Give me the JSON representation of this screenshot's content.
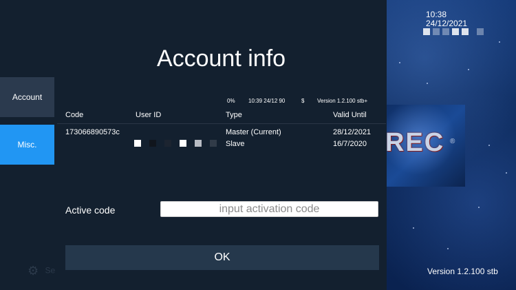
{
  "header": {
    "time": "10:38",
    "date": "24/12/2021"
  },
  "banner": {
    "text": "REC",
    "reg_mark": "®"
  },
  "footer": {
    "version": "Version 1.2.100 stb",
    "settings_label": "Se"
  },
  "sidebar": {
    "items": [
      {
        "label": "Account"
      },
      {
        "label": "Misc."
      }
    ]
  },
  "dialog": {
    "title": "Account info",
    "status": {
      "percent": "0%",
      "datetime": "10:39 24/12 90",
      "currency": "$",
      "version": "Version 1.2.100 stb+"
    },
    "table": {
      "headers": [
        "Code",
        "User ID",
        "Type",
        "Valid Until"
      ],
      "rows": [
        {
          "code": "173066890573c",
          "type": "Master (Current)",
          "valid_until": "28/12/2021"
        },
        {
          "code": "",
          "type": "Slave",
          "valid_until": "16/7/2020"
        }
      ]
    },
    "active_code_label": "Active code",
    "active_code_placeholder": "input activation code",
    "ok_label": "OK"
  },
  "colors": {
    "panel_bg": "#13202f",
    "accent_selected": "#2196f3",
    "button_bg": "#25384c"
  },
  "icons": {
    "settings": "gear-icon"
  }
}
